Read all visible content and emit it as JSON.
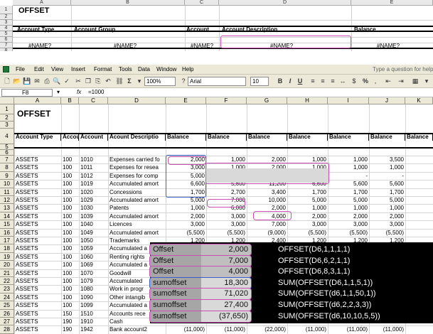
{
  "top_sheet": {
    "columns": [
      "A",
      "B",
      "C",
      "D",
      "E"
    ],
    "rows": [
      "1",
      "2",
      "3",
      "4",
      "5",
      "6",
      "7",
      "8"
    ],
    "title": "OFFSET",
    "headers": [
      "Account Type",
      "Account Group",
      "Account",
      "Account Description",
      "Balance"
    ],
    "errors": [
      "#NAME?",
      "#NAME?",
      "#NAME?",
      "#NAME?",
      "#NAME?"
    ]
  },
  "menu": {
    "items": [
      "File",
      "Edit",
      "View",
      "Insert",
      "Format",
      "Tools",
      "Data",
      "Window",
      "Help"
    ],
    "help_placeholder": "Type a question for help"
  },
  "toolbar": {
    "zoom": "100%",
    "font": "Arial",
    "size": "10",
    "bold": "B",
    "italic": "I",
    "underline": "U",
    "percent": "%"
  },
  "formula_bar": {
    "name_box": "F8",
    "fx": "fx",
    "formula": "=1000"
  },
  "sheet": {
    "columns": [
      "A",
      "B",
      "C",
      "D",
      "E",
      "F",
      "G",
      "H",
      "I",
      "J",
      "K"
    ],
    "title": "OFFSET",
    "headers": [
      "Account Type",
      "Accou",
      "Account",
      "Acount Descriptio",
      "Balance",
      "Balance",
      "Balance",
      "Balance",
      "Balance",
      "Balance",
      "Balance"
    ],
    "row_numbers": [
      "1",
      "2",
      "3",
      "4",
      "5",
      "6",
      "7",
      "8",
      "9",
      "10",
      "11",
      "12",
      "13",
      "14",
      "15",
      "16",
      "17",
      "18",
      "19",
      "20",
      "21",
      "22",
      "23",
      "24",
      "25",
      "26",
      "27",
      "28"
    ],
    "data_rows": [
      {
        "r": "7",
        "a": "ASSETS",
        "b": "100",
        "c": "1010",
        "d": "Expenses carried fo",
        "e": "2,000",
        "f": "1,000",
        "g": "2,000",
        "h": "1,000",
        "i": "1,000",
        "j": "3,500"
      },
      {
        "r": "8",
        "a": "ASSETS",
        "b": "100",
        "c": "1011",
        "d": "Expenses for resea",
        "e": "3,000",
        "f": "1,000",
        "g": "2,000",
        "h": "1,000",
        "i": "1,000",
        "j": "1,000"
      },
      {
        "r": "9",
        "a": "ASSETS",
        "b": "100",
        "c": "1012",
        "d": "Expenses for comp",
        "e": "5,000",
        "f": "-",
        "g": "-",
        "h": "-",
        "i": "-",
        "j": "-"
      },
      {
        "r": "10",
        "a": "ASSETS",
        "b": "100",
        "c": "1019",
        "d": "Accumulated amort",
        "e": "6,600",
        "f": "5,600",
        "g": "11,200",
        "h": "6,600",
        "i": "5,600",
        "j": "5,600"
      },
      {
        "r": "11",
        "a": "ASSETS",
        "b": "100",
        "c": "1020",
        "d": "Concessions",
        "e": "1,700",
        "f": "2,700",
        "g": "3,400",
        "h": "1,700",
        "i": "1,700",
        "j": "1,700"
      },
      {
        "r": "12",
        "a": "ASSETS",
        "b": "100",
        "c": "1029",
        "d": "Accumulated amort",
        "e": "5,000",
        "f": "7,000",
        "g": "10,000",
        "h": "5,000",
        "i": "5,000",
        "j": "5,000"
      },
      {
        "r": "13",
        "a": "ASSETS",
        "b": "100",
        "c": "1030",
        "d": "Patents",
        "e": "1,000",
        "f": "6,000",
        "g": "2,000",
        "h": "1,000",
        "i": "1,000",
        "j": "1,000"
      },
      {
        "r": "14",
        "a": "ASSETS",
        "b": "100",
        "c": "1039",
        "d": "Accumulated amort",
        "e": "2,000",
        "f": "3,000",
        "g": "4,000",
        "h": "2,000",
        "i": "2,000",
        "j": "2,000"
      },
      {
        "r": "15",
        "a": "ASSETS",
        "b": "100",
        "c": "1040",
        "d": "Licences",
        "e": "3,000",
        "f": "3,000",
        "g": "7,000",
        "h": "3,000",
        "i": "3,000",
        "j": "3,000"
      },
      {
        "r": "16",
        "a": "ASSETS",
        "b": "100",
        "c": "1049",
        "d": "Accumulated amort",
        "e": "(5,500)",
        "f": "(5,500)",
        "g": "(9,000)",
        "h": "(5,500)",
        "i": "(5,500)",
        "j": "(5,500)"
      },
      {
        "r": "17",
        "a": "ASSETS",
        "b": "100",
        "c": "1050",
        "d": "Trademarks",
        "e": "1,200",
        "f": "1,200",
        "g": "2,400",
        "h": "1,200",
        "i": "1,200",
        "j": "1,200"
      },
      {
        "r": "18",
        "a": "ASSETS",
        "b": "100",
        "c": "1059",
        "d": "Accumulated a",
        "e": "",
        "f": "",
        "g": "",
        "h": "",
        "i": "",
        "j": ""
      },
      {
        "r": "19",
        "a": "ASSETS",
        "b": "100",
        "c": "1060",
        "d": "Renting rights",
        "e": "",
        "f": "",
        "g": "",
        "h": "",
        "i": "",
        "j": ""
      },
      {
        "r": "20",
        "a": "ASSETS",
        "b": "100",
        "c": "1069",
        "d": "Accumulated a",
        "e": "",
        "f": "",
        "g": "",
        "h": "",
        "i": "",
        "j": ""
      },
      {
        "r": "21",
        "a": "ASSETS",
        "b": "100",
        "c": "1070",
        "d": "Goodwill",
        "e": "",
        "f": "",
        "g": "",
        "h": "",
        "i": "",
        "j": ""
      },
      {
        "r": "22",
        "a": "ASSETS",
        "b": "100",
        "c": "1079",
        "d": "Accumulated",
        "e": "",
        "f": "",
        "g": "",
        "h": "",
        "i": "",
        "j": ""
      },
      {
        "r": "23",
        "a": "ASSETS",
        "b": "100",
        "c": "1080",
        "d": "Work in progr",
        "e": "",
        "f": "",
        "g": "",
        "h": "",
        "i": "",
        "j": ""
      },
      {
        "r": "24",
        "a": "ASSETS",
        "b": "100",
        "c": "1090",
        "d": "Other intangib",
        "e": "",
        "f": "",
        "g": "",
        "h": "",
        "i": "",
        "j": ""
      },
      {
        "r": "25",
        "a": "ASSETS",
        "b": "100",
        "c": "1099",
        "d": "Accumulated a",
        "e": "",
        "f": "",
        "g": "",
        "h": "",
        "i": "",
        "j": ""
      },
      {
        "r": "26",
        "a": "ASSETS",
        "b": "150",
        "c": "1510",
        "d": "Accounts rece",
        "e": "",
        "f": "",
        "g": "",
        "h": "",
        "i": "",
        "j": ""
      },
      {
        "r": "27",
        "a": "ASSETS",
        "b": "190",
        "c": "1910",
        "d": "Cash",
        "e": "",
        "f": "",
        "g": "",
        "h": "",
        "i": "",
        "j": ""
      },
      {
        "r": "28",
        "a": "ASSETS",
        "b": "190",
        "c": "1942",
        "d": "Bank account2",
        "e": "(11,000)",
        "f": "(11,000)",
        "g": "(22,000)",
        "h": "(11,000)",
        "i": "(11,000)",
        "j": "(11,000)"
      }
    ]
  },
  "overlay": {
    "rows": [
      {
        "label": "Offset",
        "value": "2,000",
        "formula": "OFFSET(D6,1,1,1,1)"
      },
      {
        "label": "Offset",
        "value": "7,000",
        "formula": "OFFSET(D6,6,2,1,1)"
      },
      {
        "label": "Offset",
        "value": "4,000",
        "formula": "OFFSET(D6,8,3,1,1)"
      },
      {
        "label": "sumoffset",
        "value": "18,300",
        "formula": "SUM(OFFSET(D6,1,1,5,1))"
      },
      {
        "label": "sumoffset",
        "value": "71,020",
        "formula": "SUM(OFFSET(d6,1,1,50,1))"
      },
      {
        "label": "sumoffset",
        "value": "27,400",
        "formula": "SUM(OFFSET(d6,2,2,3,3))"
      },
      {
        "label": "sumoffset",
        "value": "(37,650)",
        "formula": "SUM(OFFSET(d6,10,10,5,5))"
      }
    ]
  },
  "colors": {
    "highlight_ring": "#c850b4",
    "blue_ring": "#3b5fc4",
    "overlay_bg": "#000000",
    "label_bg": "#a6a6a6"
  }
}
